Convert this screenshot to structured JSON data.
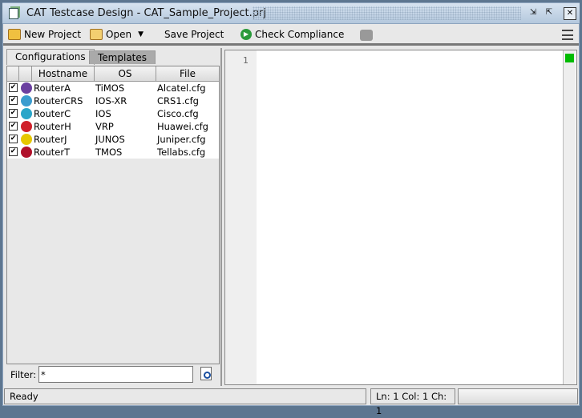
{
  "window": {
    "title": "CAT Testcase Design - CAT_Sample_Project.prj"
  },
  "toolbar": {
    "new_project": "New Project",
    "open": "Open",
    "save_project": "Save Project",
    "check_compliance": "Check Compliance"
  },
  "tabs": [
    {
      "label": "Configurations",
      "active": true
    },
    {
      "label": "Templates",
      "active": false
    }
  ],
  "table": {
    "columns": [
      "Hostname",
      "OS",
      "File"
    ],
    "rows": [
      {
        "checked": true,
        "icon": "alcatel-icon",
        "color": "#6b3fa0",
        "hostname": "RouterA",
        "os": "TiMOS",
        "file": "Alcatel.cfg"
      },
      {
        "checked": true,
        "icon": "cisco-crs-icon",
        "color": "#3a9ccf",
        "hostname": "RouterCRS",
        "os": "IOS-XR",
        "file": "CRS1.cfg"
      },
      {
        "checked": true,
        "icon": "cisco-router-icon",
        "color": "#2aa6c9",
        "hostname": "RouterC",
        "os": "IOS",
        "file": "Cisco.cfg"
      },
      {
        "checked": true,
        "icon": "huawei-icon",
        "color": "#d0202a",
        "hostname": "RouterH",
        "os": "VRP",
        "file": "Huawei.cfg"
      },
      {
        "checked": true,
        "icon": "juniper-icon",
        "color": "#e6c800",
        "hostname": "RouterJ",
        "os": "JUNOS",
        "file": "Juniper.cfg"
      },
      {
        "checked": true,
        "icon": "tellabs-icon",
        "color": "#b0102a",
        "hostname": "RouterT",
        "os": "TMOS",
        "file": "Tellabs.cfg"
      }
    ]
  },
  "filter": {
    "label": "Filter:",
    "value": "*"
  },
  "editor": {
    "line_number": "1",
    "marker_color": "#00bb00"
  },
  "status": {
    "message": "Ready",
    "position": "Ln: 1 Col: 1 Ch: 1"
  }
}
